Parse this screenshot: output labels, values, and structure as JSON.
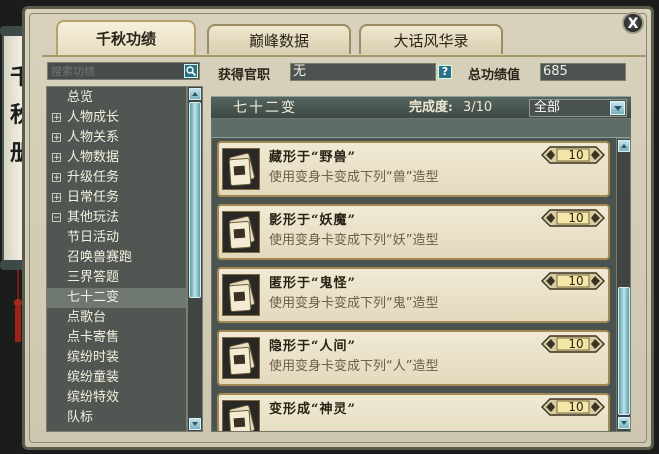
{
  "banner": {
    "title": "千\n秋\n册"
  },
  "close_label": "X",
  "tabs": [
    {
      "label": "千秋功绩"
    },
    {
      "label": "巅峰数据"
    },
    {
      "label": "大话风华录"
    }
  ],
  "search": {
    "placeholder": "搜索功绩",
    "button_icon": "search-icon"
  },
  "nav": {
    "items": [
      {
        "label": "总览",
        "expandable": false
      },
      {
        "label": "人物成长",
        "expandable": true
      },
      {
        "label": "人物关系",
        "expandable": true
      },
      {
        "label": "人物数据",
        "expandable": true
      },
      {
        "label": "升级任务",
        "expandable": true
      },
      {
        "label": "日常任务",
        "expandable": true
      },
      {
        "label": "其他玩法",
        "expandable": true,
        "expanded": true
      },
      {
        "label": "节日活动",
        "expandable": false,
        "child": true
      },
      {
        "label": "召唤兽赛跑",
        "expandable": false,
        "child": true
      },
      {
        "label": "三界答题",
        "expandable": false,
        "child": true
      },
      {
        "label": "七十二变",
        "expandable": false,
        "child": true,
        "selected": true
      },
      {
        "label": "点歌台",
        "expandable": false,
        "child": true
      },
      {
        "label": "点卡寄售",
        "expandable": false,
        "child": true
      },
      {
        "label": "缤纷时装",
        "expandable": false,
        "child": true
      },
      {
        "label": "缤纷童装",
        "expandable": false,
        "child": true
      },
      {
        "label": "缤纷特效",
        "expandable": false,
        "child": true
      },
      {
        "label": "队标",
        "expandable": false,
        "child": true
      }
    ]
  },
  "info": {
    "official_label": "获得官职",
    "official_value": "无",
    "help_label": "?",
    "total_label": "总功绩值",
    "total_value": "685"
  },
  "category": {
    "title": "七十二变",
    "progress_label": "完成度:",
    "progress_value": "3/10",
    "filter_value": "全部"
  },
  "achievements": [
    {
      "title": "藏形于“野兽”",
      "desc": "使用变身卡变成下列“兽”造型",
      "points": "10"
    },
    {
      "title": "影形于“妖魔”",
      "desc": "使用变身卡变成下列“妖”造型",
      "points": "10"
    },
    {
      "title": "匿形于“鬼怪”",
      "desc": "使用变身卡变成下列“鬼”造型",
      "points": "10"
    },
    {
      "title": "隐形于“人间”",
      "desc": "使用变身卡变成下列“人”造型",
      "points": "10"
    },
    {
      "title": "变形成“神灵”",
      "desc": "",
      "points": "10"
    }
  ],
  "colors": {
    "accent": "#2d6f85",
    "panel": "#4d5351",
    "card": "#ece4cc",
    "gold": "#a28a52"
  }
}
